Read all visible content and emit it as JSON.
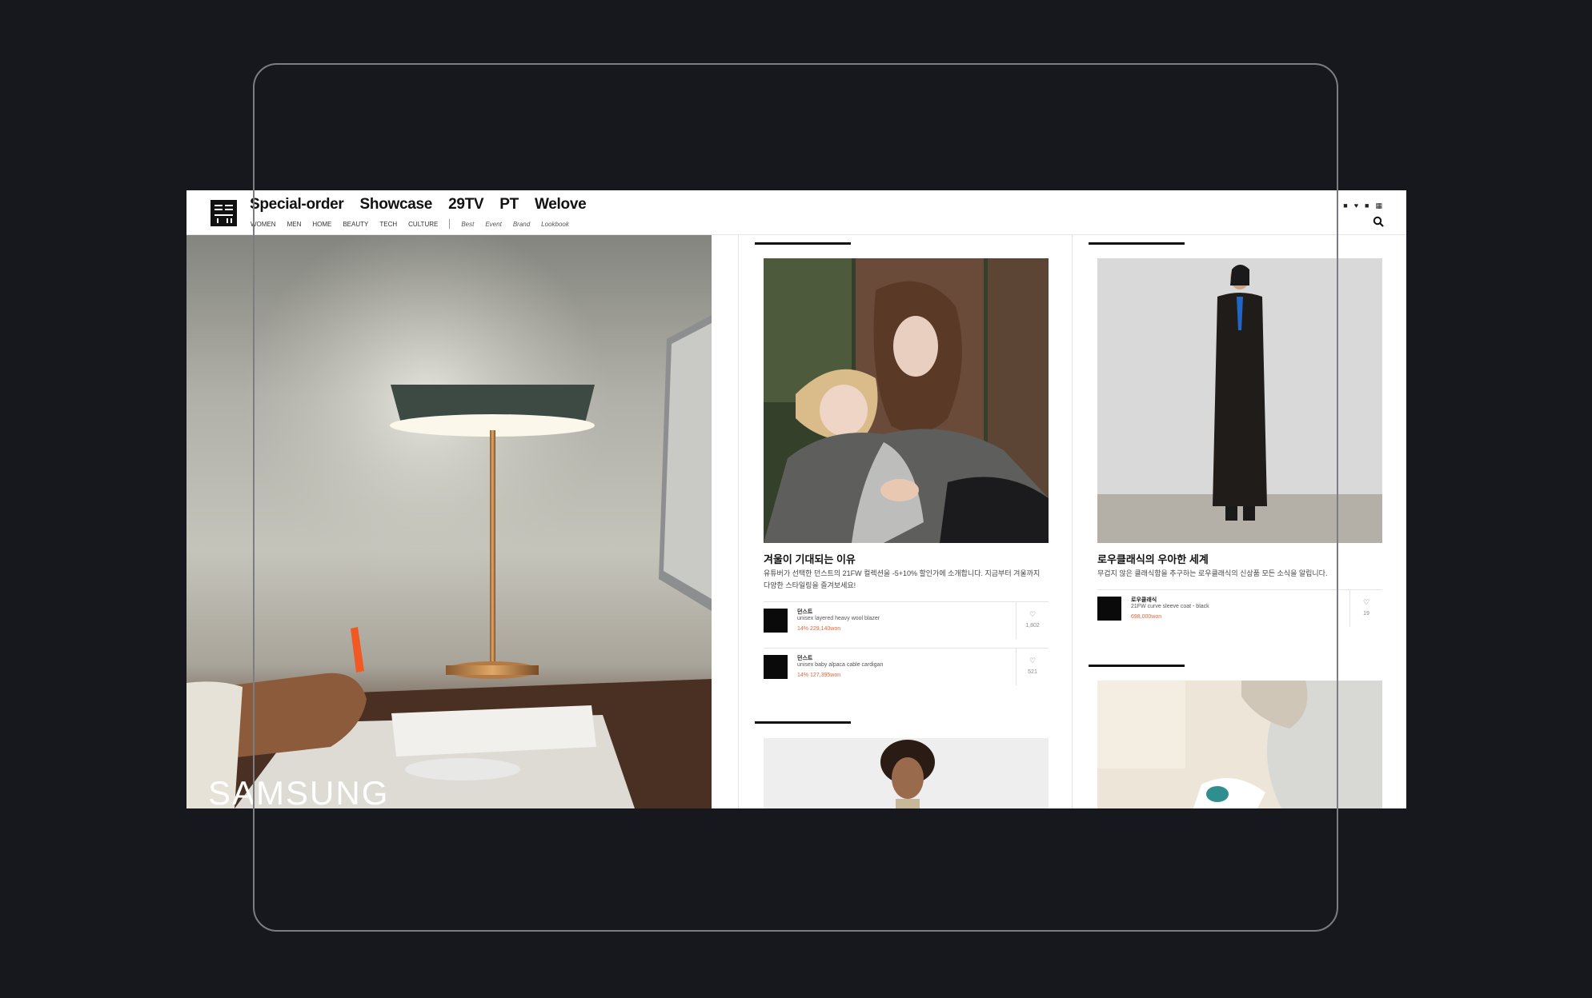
{
  "nav": {
    "main": [
      "Special-order",
      "Showcase",
      "29TV",
      "PT",
      "Welove"
    ],
    "sub": [
      "WOMEN",
      "MEN",
      "HOME",
      "BEAUTY",
      "TECH",
      "CULTURE"
    ],
    "sub_italic": [
      "Best",
      "Event",
      "Brand",
      "Lookbook"
    ]
  },
  "hero": {
    "brand": "SAMSUNG"
  },
  "cards": [
    {
      "title": "겨울이 기대되는 이유",
      "desc": "유튜버가 선택한 던스트의 21FW 컬렉션을 -5+10% 할인가에 소개합니다. 지금부터 겨울까지 다양한 스타일링을 즐겨보세요!",
      "items": [
        {
          "brand": "던스트",
          "name": "unisex layered heavy wool blazer",
          "price": "14% 229,140won",
          "likes": "1,802"
        },
        {
          "brand": "던스트",
          "name": "unisex baby alpaca cable cardigan",
          "price": "14% 127,395won",
          "likes": "521"
        }
      ]
    },
    {
      "title": "로우클래식의 우아한 세계",
      "desc": "무겁지 않은 클래식함을 추구하는 로우클래식의 신상품 모든 소식을 알립니다.",
      "items": [
        {
          "brand": "로우클래식",
          "name": "21FW curve sleeve coat - black",
          "price": "698,000won",
          "likes": "19"
        }
      ]
    }
  ],
  "colors": {
    "accent_price": "#e8633c",
    "background": "#17181d",
    "frame": "#7c7d82"
  }
}
